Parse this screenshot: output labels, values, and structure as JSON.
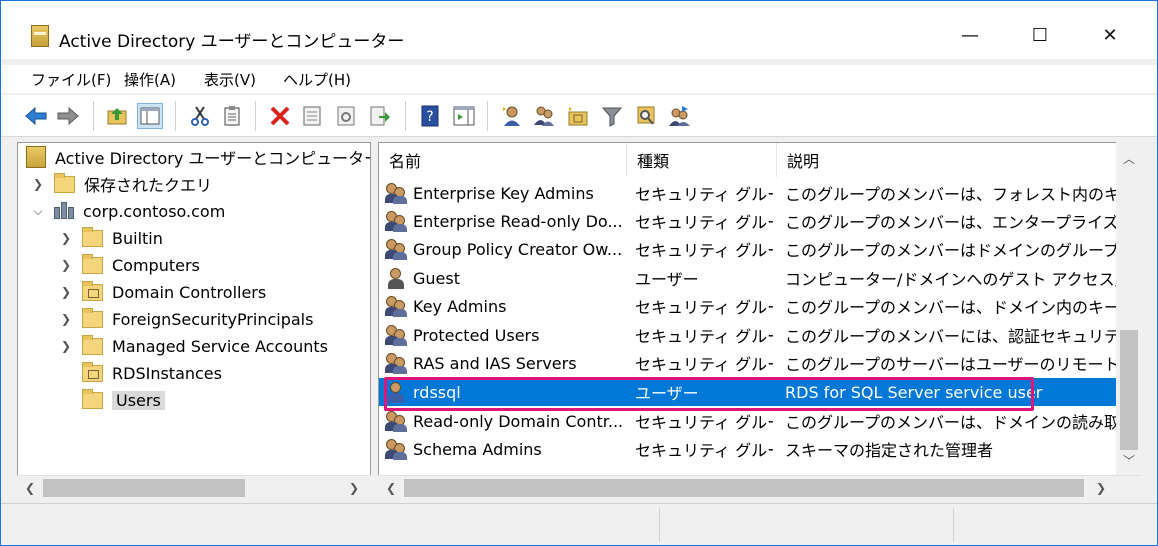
{
  "window": {
    "title": "Active Directory ユーザーとコンピューター",
    "minimize_glyph": "—",
    "maximize_glyph": "☐",
    "close_glyph": "✕"
  },
  "menu": [
    "ファイル(F)",
    "操作(A)",
    "表示(V)",
    "ヘルプ(H)"
  ],
  "toolbar": {
    "icons": [
      "back-arrow-icon",
      "forward-arrow-icon",
      "up-folder-icon",
      "show-console-tree-icon",
      "cut-icon",
      "copy-icon",
      "delete-icon",
      "properties-icon",
      "refresh-icon",
      "export-list-icon",
      "help-icon",
      "action-pane-icon",
      "new-user-icon",
      "new-group-icon",
      "new-ou-icon",
      "filter-icon",
      "find-icon",
      "add-to-group-icon"
    ]
  },
  "tree": {
    "root": "Active Directory ユーザーとコンピューター [adds",
    "saved_queries": "保存されたクエリ",
    "domain": "corp.contoso.com",
    "children": [
      "Builtin",
      "Computers",
      "Domain Controllers",
      "ForeignSecurityPrincipals",
      "Managed Service Accounts",
      "RDSInstances",
      "Users"
    ],
    "selected": "Users"
  },
  "list": {
    "columns": [
      "名前",
      "種類",
      "説明"
    ],
    "rows": [
      {
        "name": "Enterprise Key Admins",
        "type": "セキュリティ グルー...",
        "desc": "このグループのメンバーは、フォレスト内のキー オブジ",
        "icon": "group-icon"
      },
      {
        "name": "Enterprise Read-only Do...",
        "type": "セキュリティ グルー...",
        "desc": "このグループのメンバーは、エンタープライズの読み取",
        "icon": "group-icon"
      },
      {
        "name": "Group Policy Creator Ow...",
        "type": "セキュリティ グルー...",
        "desc": "このグループのメンバーはドメインのグループ ポリシー.",
        "icon": "group-icon"
      },
      {
        "name": "Guest",
        "type": "ユーザー",
        "desc": "コンピューター/ドメインへのゲスト アクセス用 (ビルト.",
        "icon": "user-icon"
      },
      {
        "name": "Key Admins",
        "type": "セキュリティ グルー...",
        "desc": "このグループのメンバーは、ドメイン内のキー オブジェ.",
        "icon": "group-icon"
      },
      {
        "name": "Protected Users",
        "type": "セキュリティ グルー...",
        "desc": "このグループのメンバーには、認証セキュリティの脅.",
        "icon": "group-icon"
      },
      {
        "name": "RAS and IAS Servers",
        "type": "セキュリティ グルー...",
        "desc": "このグループのサーバーはユーザーのリモート アクセス.",
        "icon": "group-icon"
      },
      {
        "name": "rdssql",
        "type": "ユーザー",
        "desc": "RDS for SQL Server service user",
        "icon": "user-icon"
      },
      {
        "name": "Read-only Domain Contr...",
        "type": "セキュリティ グルー...",
        "desc": "このグループのメンバーは、ドメインの読み取り専用",
        "icon": "group-icon"
      },
      {
        "name": "Schema Admins",
        "type": "セキュリティ グルー...",
        "desc": "スキーマの指定された管理者",
        "icon": "group-icon"
      }
    ],
    "selected_index": 7
  },
  "colors": {
    "selection": "#0078d7",
    "highlight_border": "#e0157a"
  }
}
